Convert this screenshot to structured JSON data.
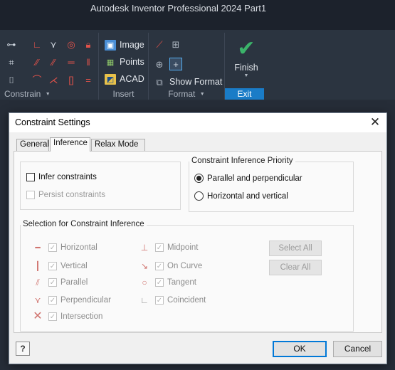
{
  "app": {
    "title": "Autodesk Inventor Professional 2024    Part1"
  },
  "ribbon": {
    "constrain": {
      "label": "Constrain",
      "caret": "▼",
      "icons": [
        "coincident-tool",
        "perpendicular-tool",
        "tangent-tool",
        "concentric-tool",
        "fix-tool",
        "collinear-tool",
        "parallel-tool",
        "horizontal-tool",
        "equal-tool",
        "vertical-tool",
        "smooth-tool",
        "symmetric-tool",
        "auto-dimension-tool",
        "constraint-settings-tool",
        "show-constraints-tool"
      ]
    },
    "insert": {
      "label": "Insert",
      "image": "Image",
      "points": "Points",
      "acad": "ACAD"
    },
    "format": {
      "label": "Format",
      "caret": "▼",
      "show_format": "Show Format"
    },
    "exit": {
      "finish": "Finish",
      "label": "Exit"
    }
  },
  "dialog": {
    "title": "Constraint Settings",
    "close": "✕",
    "tabs": [
      {
        "label": "General",
        "active": false
      },
      {
        "label": "Inference",
        "active": true
      },
      {
        "label": "Relax Mode",
        "active": false
      }
    ],
    "infer_constraints": {
      "label": "Infer constraints",
      "checked": false
    },
    "persist_constraints": {
      "label": "Persist constraints",
      "checked": false,
      "enabled": false
    },
    "priority": {
      "title": "Constraint Inference Priority",
      "options": [
        {
          "label": "Parallel and perpendicular",
          "checked": true
        },
        {
          "label": "Horizontal and vertical",
          "checked": false
        }
      ]
    },
    "selection": {
      "title": "Selection for Constraint Inference",
      "items": [
        {
          "label": "Horizontal",
          "icon": "horizontal-icon",
          "checked": true
        },
        {
          "label": "Vertical",
          "icon": "vertical-icon",
          "checked": true
        },
        {
          "label": "Parallel",
          "icon": "parallel-icon",
          "checked": true
        },
        {
          "label": "Perpendicular",
          "icon": "perpendicular-icon",
          "checked": true
        },
        {
          "label": "Intersection",
          "icon": "intersection-icon",
          "checked": true
        },
        {
          "label": "Midpoint",
          "icon": "midpoint-icon",
          "checked": true
        },
        {
          "label": "On Curve",
          "icon": "on-curve-icon",
          "checked": true
        },
        {
          "label": "Tangent",
          "icon": "tangent-icon",
          "checked": true
        },
        {
          "label": "Coincident",
          "icon": "coincident-icon",
          "checked": true
        }
      ],
      "select_all": "Select All",
      "clear_all": "Clear All"
    },
    "help": "?",
    "ok": "OK",
    "cancel": "Cancel"
  }
}
